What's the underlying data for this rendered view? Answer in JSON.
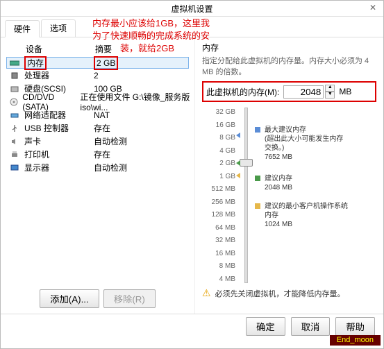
{
  "window_title": "虚拟机设置",
  "annotation_lines": [
    "内存最小应该给1GB，这里我",
    "为了快速顺畅的完成系统的安",
    "装，就给2GB"
  ],
  "tabs": {
    "hardware": "硬件",
    "options": "选项"
  },
  "columns": {
    "device": "设备",
    "summary": "摘要"
  },
  "rows": [
    {
      "icon": "memory-icon",
      "name": "内存",
      "summary": "2 GB",
      "selected": true,
      "boxed": true
    },
    {
      "icon": "cpu-icon",
      "name": "处理器",
      "summary": "2"
    },
    {
      "icon": "disk-icon",
      "name": "硬盘(SCSI)",
      "summary": "100 GB"
    },
    {
      "icon": "cd-icon",
      "name": "CD/DVD (SATA)",
      "summary": "正在使用文件 G:\\镜像_服务版iso\\wi..."
    },
    {
      "icon": "net-icon",
      "name": "网络适配器",
      "summary": "NAT"
    },
    {
      "icon": "usb-icon",
      "name": "USB 控制器",
      "summary": "存在"
    },
    {
      "icon": "sound-icon",
      "name": "声卡",
      "summary": "自动检测"
    },
    {
      "icon": "printer-icon",
      "name": "打印机",
      "summary": "存在"
    },
    {
      "icon": "display-icon",
      "name": "显示器",
      "summary": "自动检测"
    }
  ],
  "left_buttons": {
    "add": "添加(A)...",
    "remove": "移除(R)"
  },
  "memory": {
    "title": "内存",
    "desc": "指定分配给此虚拟机的内存量。内存大小必须为 4 MB 的倍数。",
    "field_label": "此虚拟机的内存(M):",
    "value": "2048",
    "unit": "MB",
    "ticks": [
      "32 GB",
      "16 GB",
      "8 GB",
      "4 GB",
      "2 GB",
      "1 GB",
      "512 MB",
      "256 MB",
      "128 MB",
      "64 MB",
      "32 MB",
      "16 MB",
      "8 MB",
      "4 MB"
    ],
    "max_label": "最大建议内存",
    "max_note": "(超出此大小可能发生内存交换。)",
    "max_val": "7652 MB",
    "rec_label": "建议内存",
    "rec_val": "2048 MB",
    "min_label": "建议的最小客户机操作系统内存",
    "min_val": "1024 MB",
    "warning": "必须先关闭虚拟机，才能降低内存量。",
    "colors": {
      "max": "#5b8dd6",
      "rec": "#4a9a4a",
      "min": "#e6b84a"
    }
  },
  "bottom": {
    "ok": "确定",
    "cancel": "取消",
    "help": "帮助"
  },
  "watermark": "End_moon"
}
